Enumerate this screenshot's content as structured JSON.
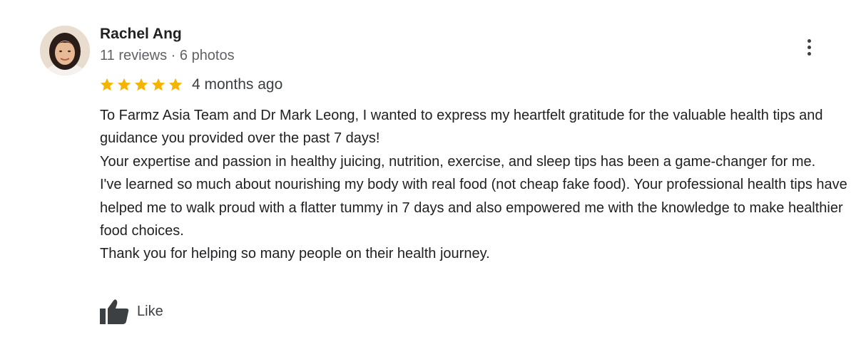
{
  "review": {
    "author": {
      "name": "Rachel Ang",
      "meta": "11 reviews · 6 photos",
      "avatar_icon": "user-avatar-photo"
    },
    "rating": {
      "stars": 5,
      "max": 5,
      "star_color": "#f5b400"
    },
    "time_ago": "4 months ago",
    "paragraphs": [
      "To Farmz Asia Team and Dr Mark Leong, I wanted to express my heartfelt gratitude for the valuable health tips and guidance you provided over the past 7 days!",
      "Your expertise and passion in healthy juicing, nutrition, exercise, and sleep tips has been a game-changer for me.",
      "I've learned so much about nourishing my body with real food (not cheap fake food). Your professional health tips have helped me to walk proud with a flatter tummy in 7 days and also empowered me with the knowledge to make healthier food choices.",
      "Thank you for helping so many people on their health journey."
    ],
    "actions": {
      "like_label": "Like",
      "like_icon": "thumbs-up-icon",
      "more_icon": "more-vert-icon"
    }
  }
}
